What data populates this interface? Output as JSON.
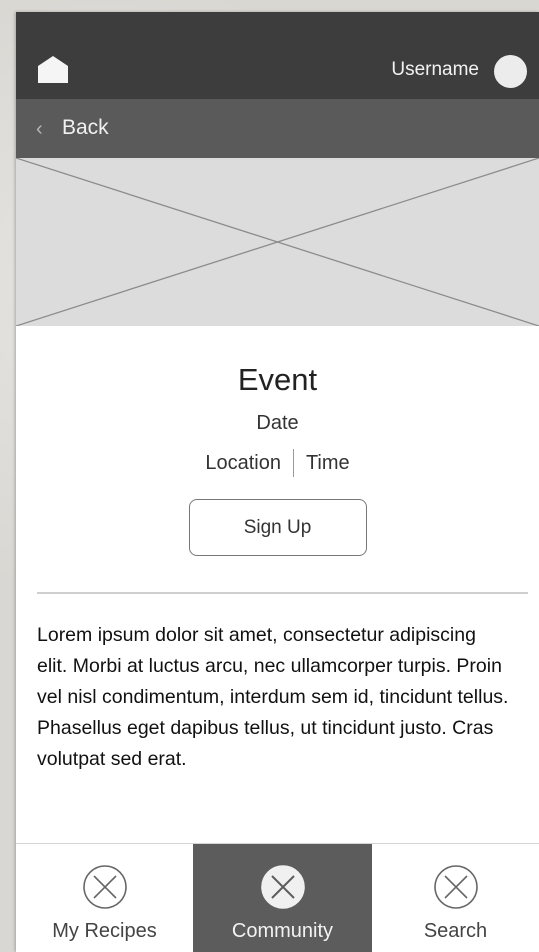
{
  "header": {
    "home_icon": "home-icon",
    "username": "Username",
    "avatar_icon": "avatar-circle"
  },
  "backbar": {
    "chevron_icon": "chevron-left-icon",
    "label": "Back"
  },
  "hero": {
    "placeholder": "image-placeholder"
  },
  "event": {
    "title": "Event",
    "date": "Date",
    "location": "Location",
    "time": "Time",
    "signup_label": "Sign Up"
  },
  "description": "Lorem ipsum dolor sit amet, consectetur adipiscing elit. Morbi at luctus arcu, nec ullamcorper turpis. Proin vel nisl condimentum, interdum sem id, tincidunt tellus. Phasellus eget dapibus tellus, ut tincidunt justo. Cras volutpat sed erat.",
  "tabs": [
    {
      "label": "My Recipes",
      "icon": "placeholder-icon",
      "active": false
    },
    {
      "label": "Community",
      "icon": "placeholder-icon",
      "active": true
    },
    {
      "label": "Search",
      "icon": "placeholder-icon",
      "active": false
    }
  ],
  "colors": {
    "topbar": "#3d3d3d",
    "backbar": "#5a5a5a",
    "active_tab": "#5c5c5c",
    "placeholder": "#dcdcdc"
  }
}
